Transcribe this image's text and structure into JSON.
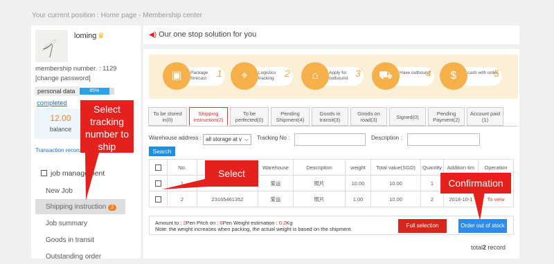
{
  "breadcrumb": "Your current position : Home page - Membership center",
  "sidebar": {
    "username": "loming",
    "membership": "membership number. : 1129",
    "change_password": "[change password]",
    "personal_data": "personal data",
    "progress": "85%",
    "progress_value": 0.85,
    "completed": "completed",
    "balance_value": "12.00",
    "balance_label": "balance",
    "transaction": "Transaction record",
    "job_heading": "job management",
    "items": [
      {
        "label": "New Job"
      },
      {
        "label": "Shipping instruction",
        "badge": "2"
      },
      {
        "label": "Job summary"
      },
      {
        "label": "Goods in transit"
      },
      {
        "label": "Outstanding order"
      }
    ]
  },
  "slogan": "Our one stop solution for you",
  "steps": [
    {
      "label": "Package forecast",
      "num": "1",
      "icon": "box-icon"
    },
    {
      "label": "Logistics tracking",
      "num": "2",
      "icon": "map-pin-icon"
    },
    {
      "label": "Apply for outbound",
      "num": "3",
      "icon": "warehouse-icon"
    },
    {
      "label": "Have outbound",
      "num": "4",
      "icon": "truck-icon"
    },
    {
      "label": "cash with order",
      "num": "5",
      "icon": "money-bag-icon"
    }
  ],
  "tabs": [
    {
      "l1": "To be stored",
      "l2": "in(0)"
    },
    {
      "l1": "Shipping",
      "l2": "instruction(2)"
    },
    {
      "l1": "To be",
      "l2": "perfected(0)"
    },
    {
      "l1": "Pending",
      "l2": "Shipment(4)"
    },
    {
      "l1": "Goods in",
      "l2": "transit(3)"
    },
    {
      "l1": "Goods on",
      "l2": "road(3)"
    },
    {
      "l1": "Signed(0)",
      "l2": ""
    },
    {
      "l1": "Pending",
      "l2": "Payment(2)"
    },
    {
      "l1": "Account paid",
      "l2": "(1)"
    }
  ],
  "filter": {
    "warehouse_label": "Warehouse address :",
    "warehouse_value": "all storage at v",
    "tracking_label": "Tracking No :",
    "description_label": "Description :",
    "search": "Search"
  },
  "table": {
    "headers": [
      "No.",
      "",
      "Warehouse",
      "Description",
      "weight",
      "Total value(SGD)",
      "Quantity",
      "Addition tim",
      "Operation"
    ],
    "rows": [
      {
        "no": "1",
        "tracking": "3926363126929",
        "warehouse": "爱运",
        "desc": "照片",
        "weight": "10.00",
        "value": "10.00",
        "qty": "1",
        "time": "",
        "op": ""
      },
      {
        "no": "2",
        "tracking": "23165461352",
        "warehouse": "爱运",
        "desc": "照片",
        "weight": "1.00",
        "value": "10.00",
        "qty": "2",
        "time": "2018-10-1",
        "op": "To view"
      }
    ]
  },
  "summary": {
    "a1": "Amount to : ",
    "a2": "2",
    "a3": "Pen Pitch on : ",
    "a4": "0",
    "a5": "Pen Weight estimation : ",
    "a6": "0.2",
    "a7": "Kg",
    "note": "Note: the weight increases when packing, the actual weight is based on the shipment.",
    "full_selection": "Full selection",
    "order_out": "Order out of stock"
  },
  "total": {
    "prefix": "total",
    "count": "2",
    "suffix": " record"
  },
  "annotations": {
    "tracking": "Select tracking number to ship",
    "select": "Select",
    "confirm": "Confirmation"
  }
}
